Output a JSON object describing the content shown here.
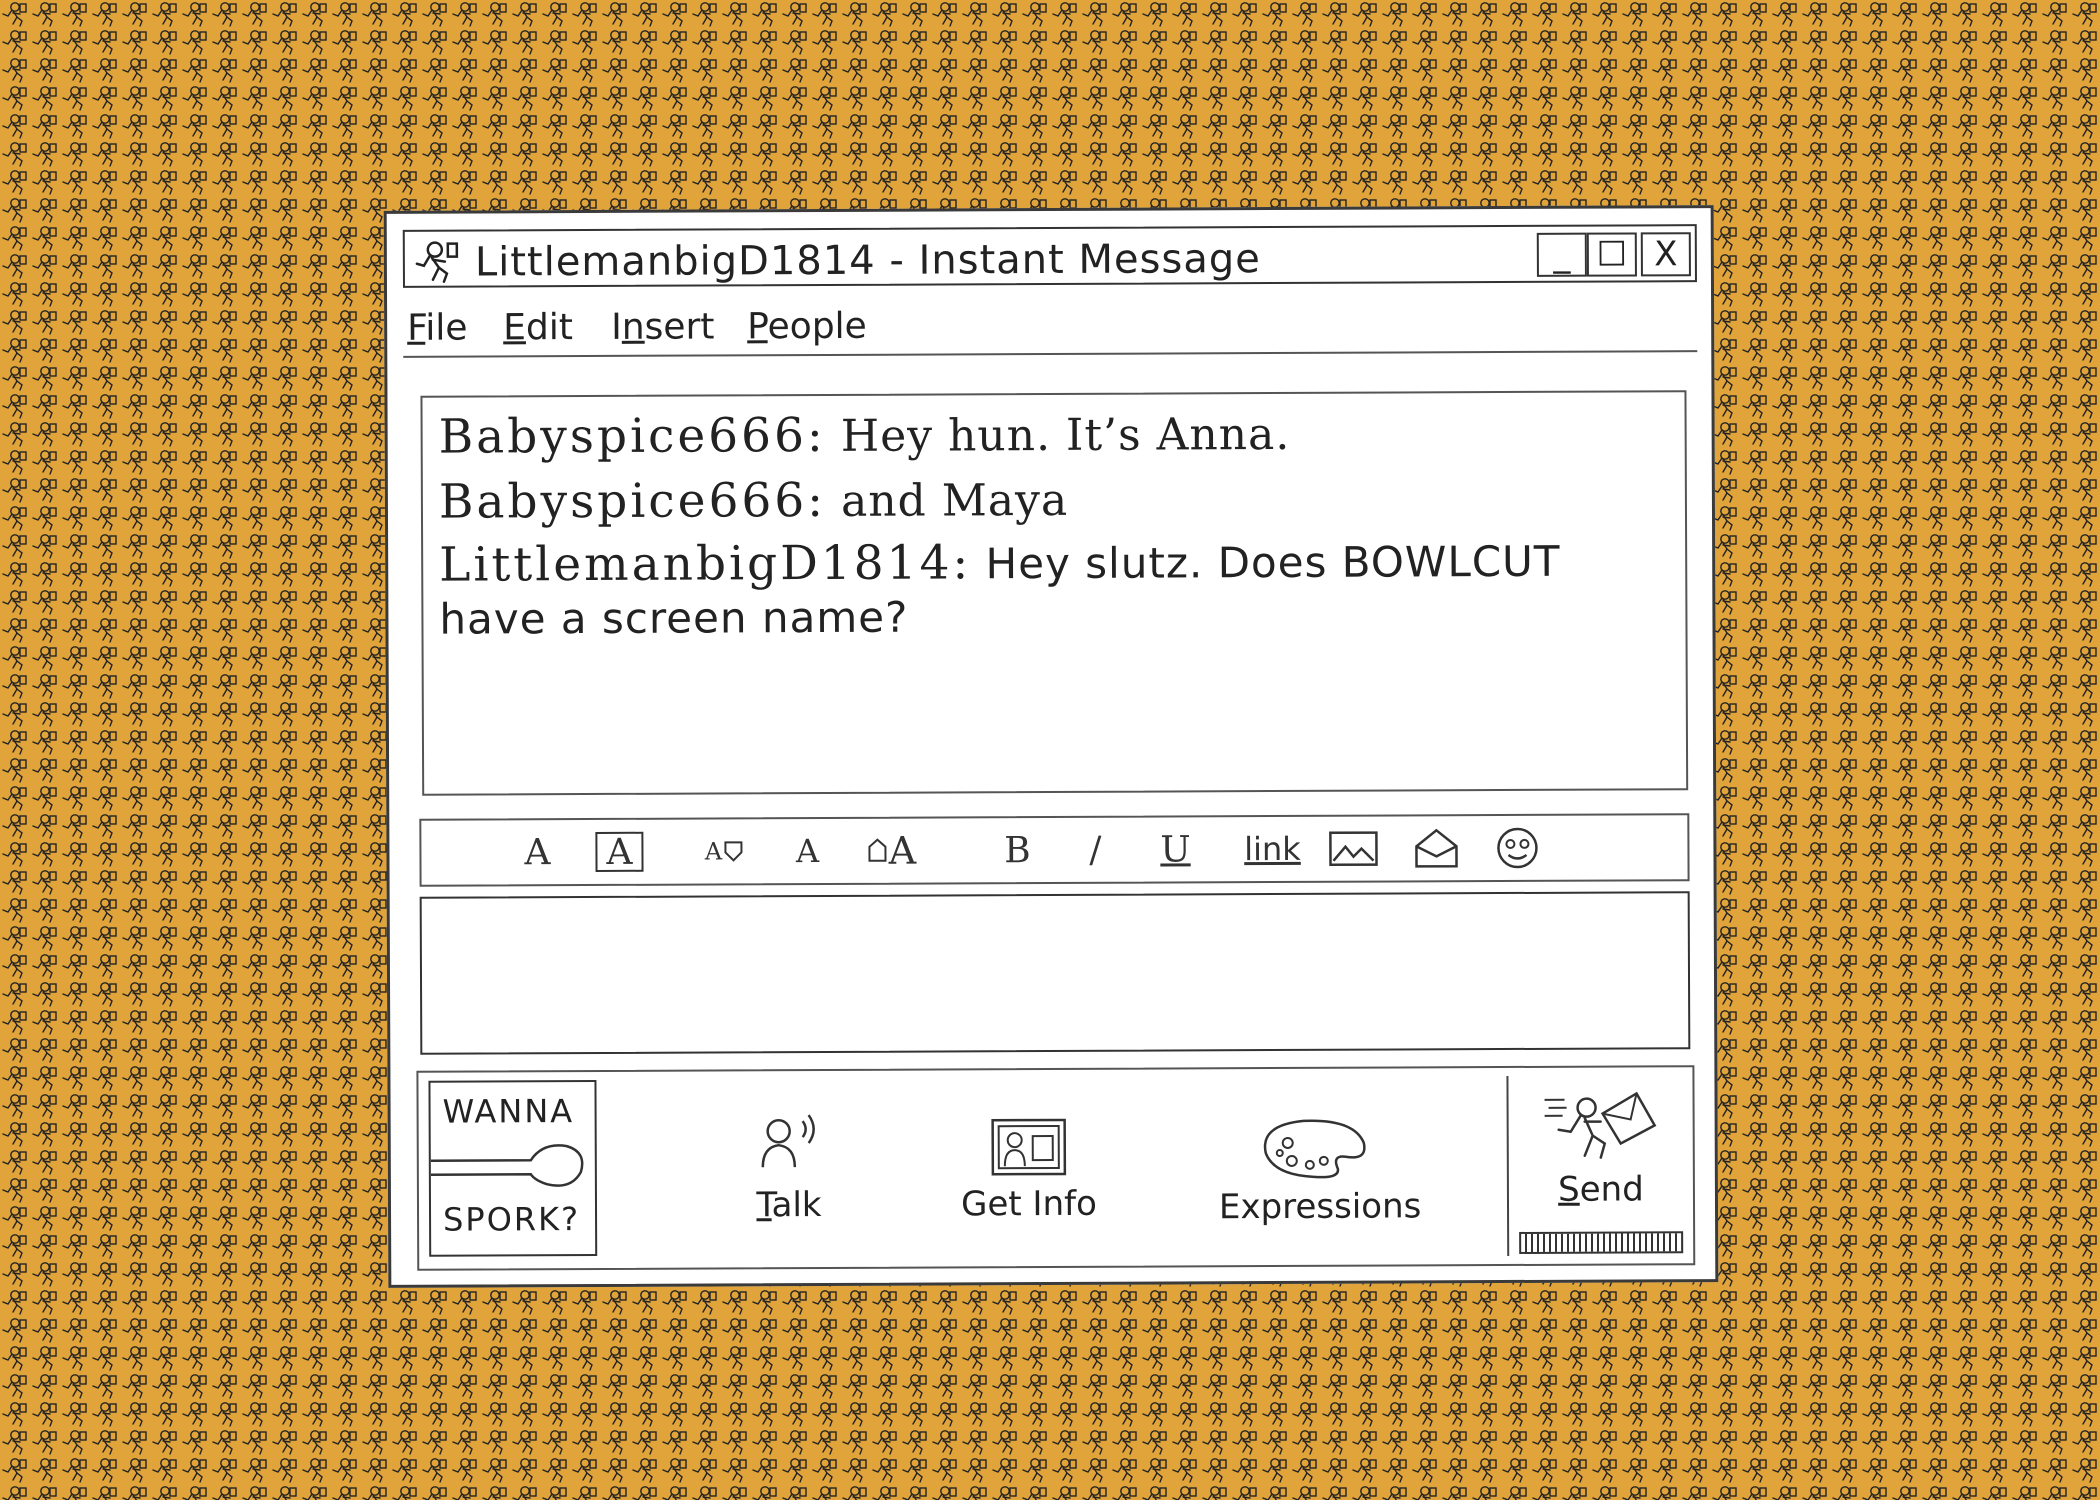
{
  "background": {
    "color": "#e0a43a",
    "pattern_icon": "running-man-icon"
  },
  "window": {
    "title": "LittlemanbigD1814 - Instant Message",
    "controls": {
      "minimize": "_",
      "maximize": "☐",
      "close": "X"
    }
  },
  "menu": {
    "file": {
      "first": "F",
      "rest": "ile"
    },
    "edit": {
      "first": "E",
      "rest": "dit"
    },
    "insert": {
      "first": "I",
      "mid": "n",
      "rest": "sert"
    },
    "people": {
      "first": "P",
      "rest": "eople"
    }
  },
  "chat": {
    "messages": [
      {
        "sender": "Babyspice666:",
        "text": " Hey hun. It’s Anna."
      },
      {
        "sender": "Babyspice666:",
        "text": " and Maya"
      },
      {
        "sender": "LittlemanbigD1814:",
        "text": " Hey slutz. Does BOWLCUT",
        "continuation": "have a screen name?"
      }
    ]
  },
  "format_toolbar": {
    "items": [
      "A",
      "A",
      "A",
      "A",
      "A",
      "B",
      "/",
      "U",
      "link"
    ],
    "icons": [
      "font-color-icon",
      "background-color-icon",
      "text-smaller-icon",
      "normal-size-icon",
      "text-bigger-icon",
      "bold-icon",
      "italic-icon",
      "underline-icon",
      "link-icon",
      "image-icon",
      "email-icon",
      "smiley-icon"
    ]
  },
  "compose": {
    "value": ""
  },
  "bottom": {
    "ad": {
      "line1": "WANNA",
      "line2": "SPORK?"
    },
    "talk": {
      "first": "T",
      "rest": "alk"
    },
    "get_info": "Get Info",
    "expressions": "Expressions",
    "send": {
      "first": "S",
      "rest": "end"
    }
  }
}
